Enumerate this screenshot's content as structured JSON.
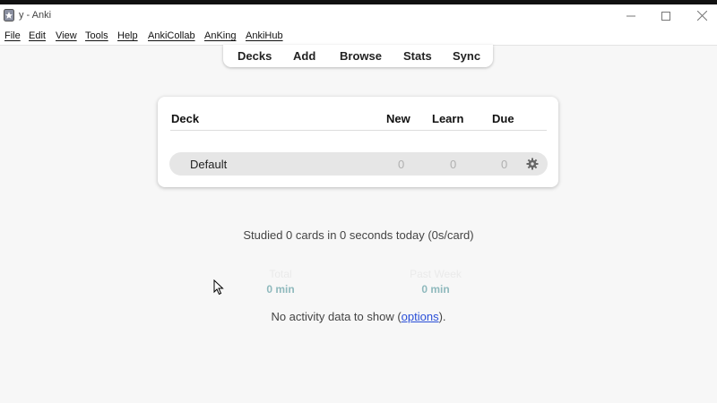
{
  "window": {
    "title": "y - Anki"
  },
  "menu": [
    "File",
    "Edit",
    "View",
    "Tools",
    "Help",
    "AnkiCollab",
    "AnKing",
    "AnkiHub"
  ],
  "toolbar": [
    "Decks",
    "Add",
    "Browse",
    "Stats",
    "Sync"
  ],
  "deck_table": {
    "headers": {
      "deck": "Deck",
      "new": "New",
      "learn": "Learn",
      "due": "Due"
    },
    "rows": [
      {
        "name": "Default",
        "new": "0",
        "learn": "0",
        "due": "0"
      }
    ]
  },
  "stats": {
    "studied_text": "Studied 0 cards in 0 seconds today (0s/card)",
    "total_label": "Total",
    "total_value": "0 min",
    "past_week_label": "Past Week",
    "past_week_value": "0 min",
    "no_activity_prefix": "No activity data to show (",
    "options_link": "options",
    "no_activity_suffix": ")."
  },
  "colors": {
    "link": "#2a4fd8",
    "stat_value": "#8fb9bd",
    "row_bg": "#e6e6e6"
  }
}
